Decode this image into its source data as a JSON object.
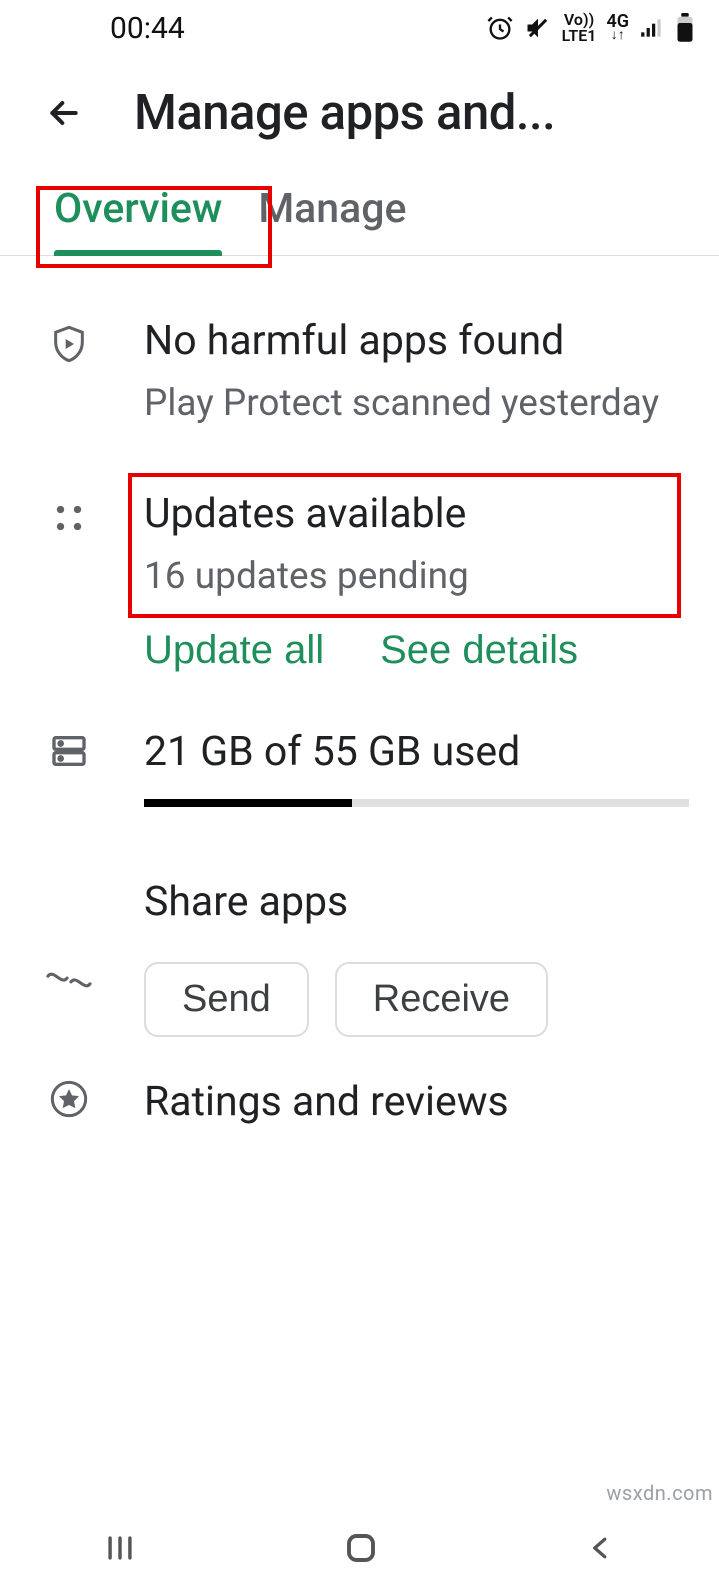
{
  "status": {
    "time": "00:44",
    "lte": "Vo))\nLTE1",
    "fourg": "4G"
  },
  "header": {
    "title": "Manage apps and..."
  },
  "tabs": {
    "overview": "Overview",
    "manage": "Manage"
  },
  "protect": {
    "title": "No harmful apps found",
    "subtitle": "Play Protect scanned yesterday"
  },
  "updates": {
    "title": "Updates available",
    "subtitle": "16 updates pending",
    "update_all": "Update all",
    "see_details": "See details"
  },
  "storage": {
    "label": "21 GB of 55 GB used",
    "used": 21,
    "total": 55
  },
  "share": {
    "title": "Share apps",
    "send": "Send",
    "receive": "Receive"
  },
  "ratings": {
    "title": "Ratings and reviews"
  },
  "watermark": "wsxdn.com"
}
